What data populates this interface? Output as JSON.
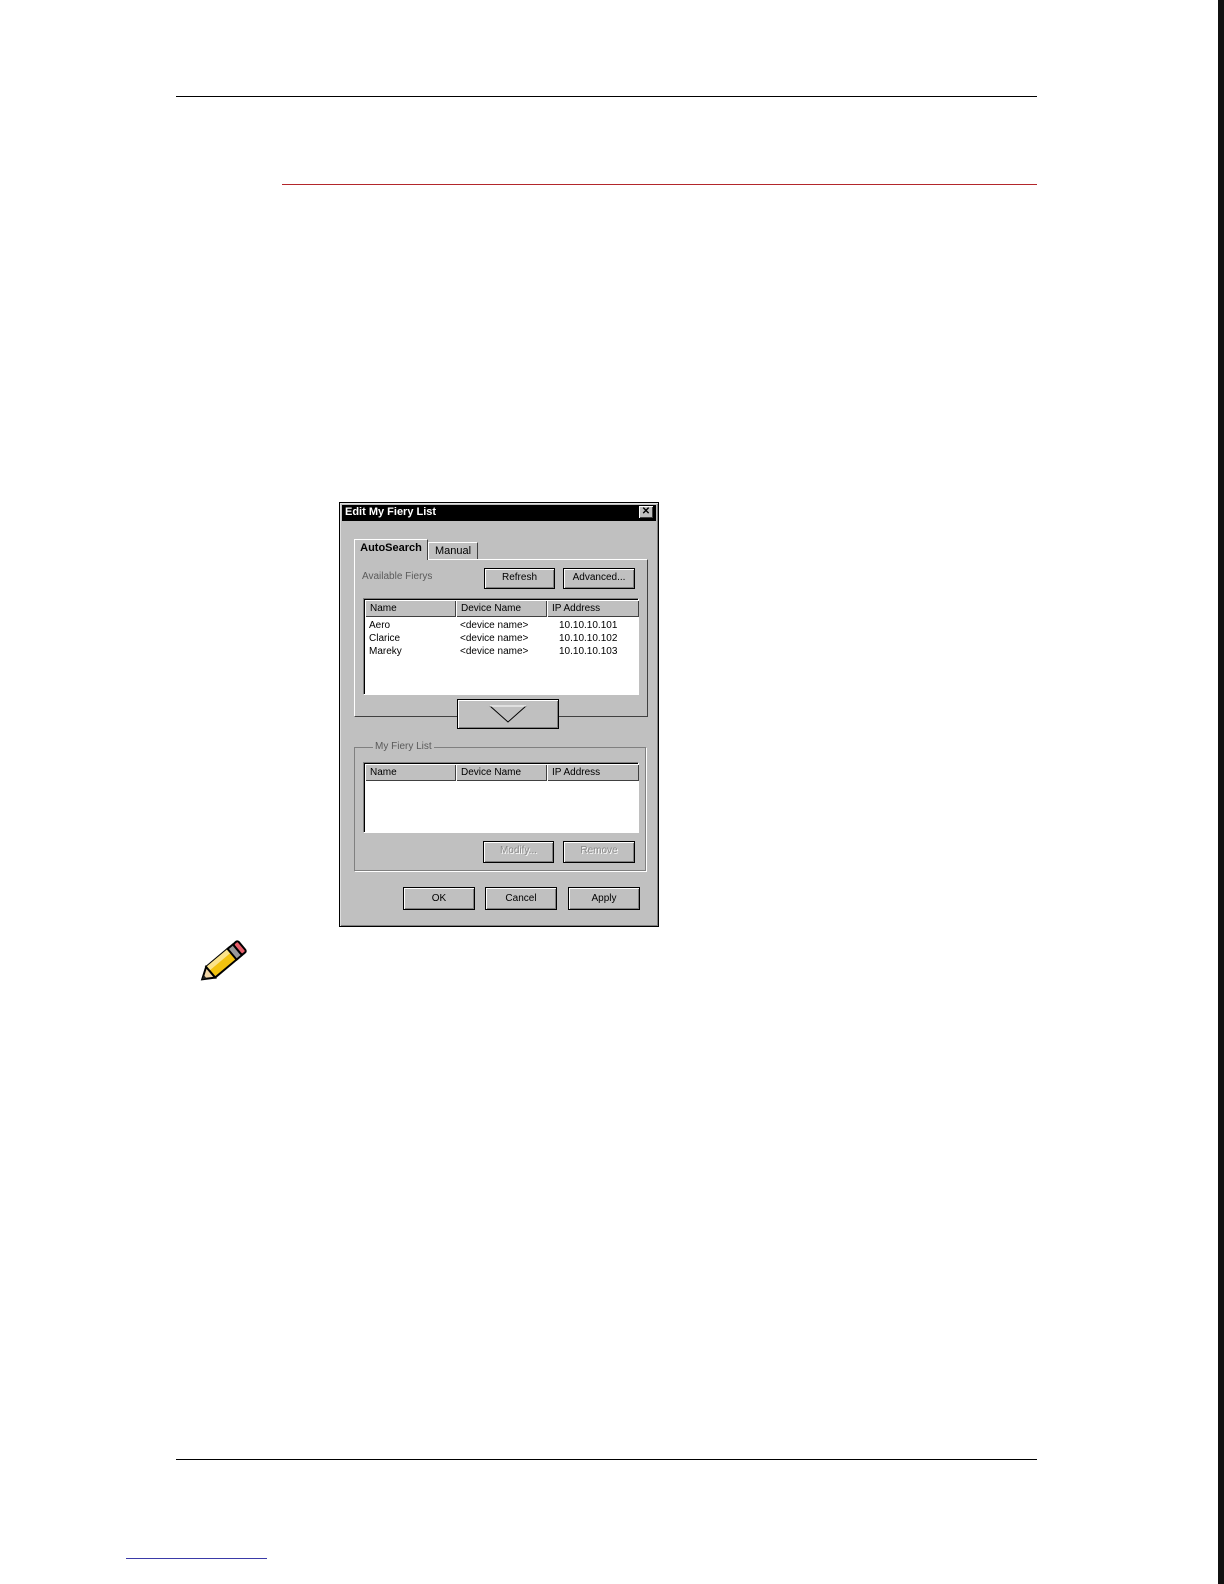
{
  "dialog": {
    "title": "Edit My Fiery List",
    "close_glyph": "✕",
    "tabs": [
      {
        "label": "AutoSearch",
        "active": true
      },
      {
        "label": "Manual",
        "active": false
      }
    ],
    "available_label": "Available Fierys",
    "refresh_label": "Refresh",
    "advanced_label": "Advanced...",
    "columns": [
      "Name",
      "Device Name",
      "IP Address"
    ],
    "available_rows": [
      {
        "name": "Aero",
        "device": "<device name>",
        "ip": "10.10.10.101"
      },
      {
        "name": "Clarice",
        "device": "<device name>",
        "ip": "10.10.10.102"
      },
      {
        "name": "Mareky",
        "device": "<device name>",
        "ip": "10.10.10.103"
      }
    ],
    "add_arrow_icon": "down-triangle-icon",
    "my_list_label": "My Fiery List",
    "modify_label": "Modify...",
    "remove_label": "Remove",
    "ok_label": "OK",
    "cancel_label": "Cancel",
    "apply_label": "Apply"
  },
  "note_icon": "pencil-icon",
  "colors": {
    "accent_rule": "#b3262b",
    "dialog_face": "#c0c0c0",
    "titlebar": "#000000"
  }
}
